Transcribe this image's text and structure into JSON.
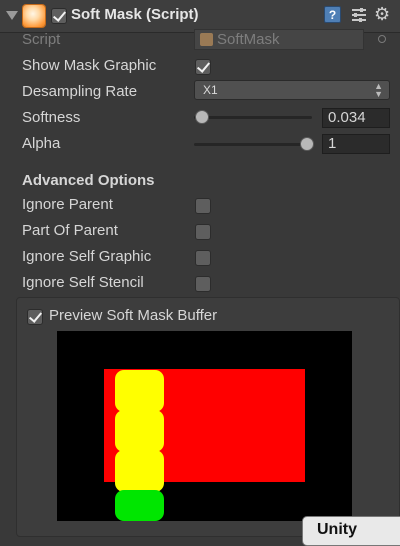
{
  "component": {
    "title": "Soft Mask (Script)",
    "help_glyph": "?",
    "gear_glyph": "⚙",
    "enabled": true
  },
  "fields": {
    "script_label": "Script",
    "script_value": "SoftMask",
    "show_mask_graphic_label": "Show Mask Graphic",
    "show_mask_graphic": true,
    "desampling_rate_label": "Desampling Rate",
    "desampling_rate_value": "X1",
    "softness_label": "Softness",
    "softness_value": "0.034",
    "alpha_label": "Alpha",
    "alpha_value": "1"
  },
  "advanced": {
    "section_title": "Advanced Options",
    "ignore_parent_label": "Ignore Parent",
    "part_of_parent_label": "Part Of Parent",
    "ignore_self_graphic_label": "Ignore Self Graphic",
    "ignore_self_stencil_label": "Ignore Self Stencil",
    "ignore_parent": false,
    "part_of_parent": false,
    "ignore_self_graphic": false,
    "ignore_self_stencil": false
  },
  "preview": {
    "label": "Preview Soft Mask Buffer",
    "enabled": true,
    "colors": {
      "background": "#000000",
      "mask": "#ff0000",
      "pill": "#ffff00",
      "pill_bottom": "#00e600"
    }
  },
  "footer": {
    "tab_label": "Unity"
  }
}
